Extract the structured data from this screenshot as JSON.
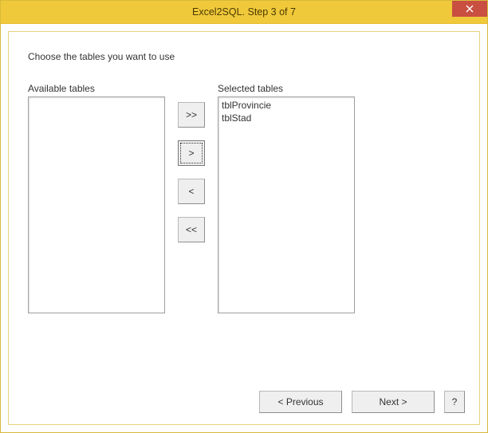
{
  "window": {
    "title": "Excel2SQL. Step 3 of 7"
  },
  "instruction": "Choose the tables you want to use",
  "labels": {
    "available": "Available tables",
    "selected": "Selected tables"
  },
  "buttons": {
    "move_all_right": ">>",
    "move_right": ">",
    "move_left": "<",
    "move_all_left": "<<",
    "previous": "< Previous",
    "next": "Next >",
    "help": "?"
  },
  "available_tables": [],
  "selected_tables": [
    "tblProvincie",
    "tblStad"
  ]
}
